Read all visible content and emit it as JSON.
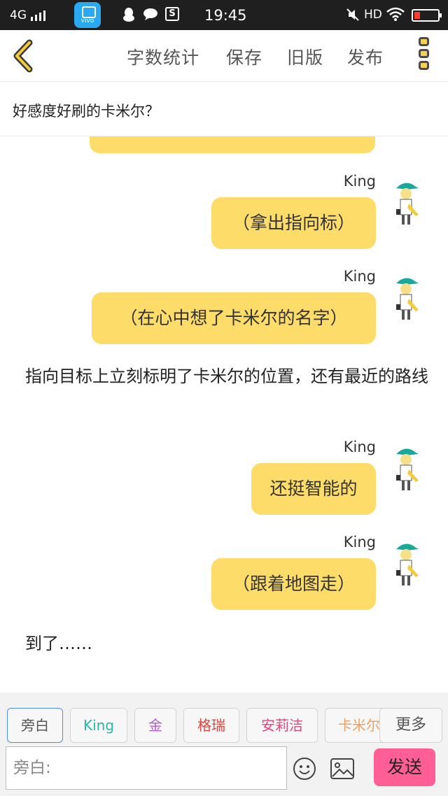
{
  "status_bar": {
    "network": "4G",
    "app_icon_label": "vivo",
    "sim_label": "S",
    "time": "19:45",
    "hd": "HD"
  },
  "toolbar": {
    "word_count": "字数统计",
    "save": "保存",
    "old_version": "旧版",
    "publish": "发布"
  },
  "story": {
    "title": "好感度好刷的卡米尔？"
  },
  "messages": [
    {
      "speaker": "King",
      "text": "（拿出指向标）"
    },
    {
      "speaker": "King",
      "text": "（在心中想了卡米尔的名字）"
    },
    {
      "text": "指向目标上立刻标明了卡米尔的位置，还有最近的路线"
    },
    {
      "speaker": "King",
      "text": "还挺智能的"
    },
    {
      "speaker": "King",
      "text": "（跟着地图走）"
    },
    {
      "text": "到了……"
    }
  ],
  "roles": {
    "items": [
      {
        "label": "旁白",
        "color": "#555555"
      },
      {
        "label": "King",
        "color": "#2bb5a8"
      },
      {
        "label": "金",
        "color": "#b45cc8"
      },
      {
        "label": "格瑞",
        "color": "#e0443c"
      },
      {
        "label": "安莉洁",
        "color": "#e0457b"
      },
      {
        "label": "卡米尔",
        "color": "#f0a060"
      }
    ],
    "more": "更多"
  },
  "input": {
    "placeholder": "旁白:",
    "send": "发送"
  },
  "colors": {
    "bubble": "#fedc6a",
    "send_button": "#ff5f95",
    "accent_border": "#4a90e2"
  },
  "icons": [
    "back-chevron-icon",
    "more-menu-icon",
    "emoji-icon",
    "image-icon",
    "wifi-icon",
    "mute-icon",
    "battery-icon",
    "signal-icon"
  ]
}
